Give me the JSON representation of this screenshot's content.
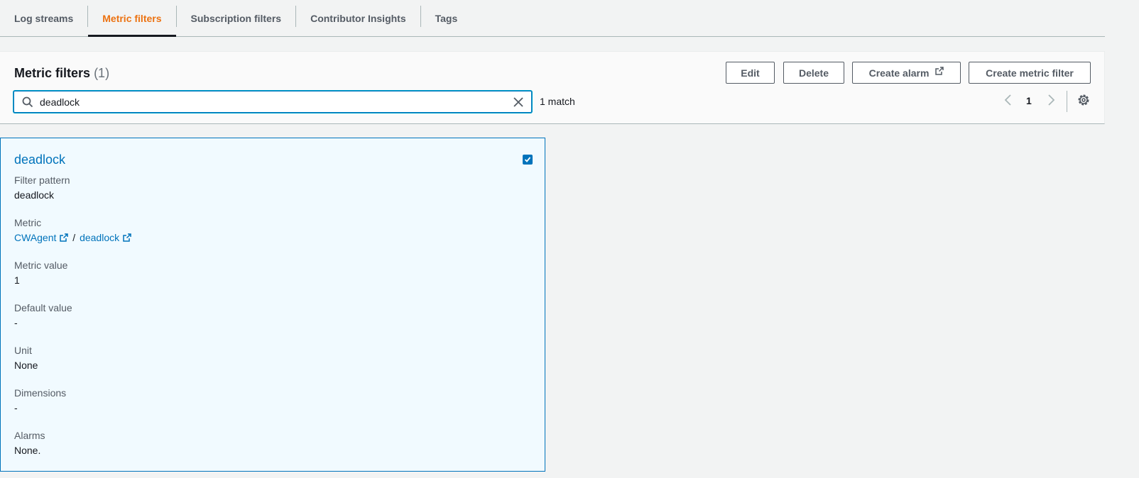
{
  "tabs": [
    {
      "label": "Log streams",
      "active": false
    },
    {
      "label": "Metric filters",
      "active": true
    },
    {
      "label": "Subscription filters",
      "active": false
    },
    {
      "label": "Contributor Insights",
      "active": false
    },
    {
      "label": "Tags",
      "active": false
    }
  ],
  "panel": {
    "title": "Metric filters",
    "count": "(1)",
    "buttons": {
      "edit": "Edit",
      "delete": "Delete",
      "create_alarm": "Create alarm",
      "create_metric_filter": "Create metric filter"
    },
    "search": {
      "value": "deadlock",
      "placeholder": ""
    },
    "match_text": "1 match",
    "page": "1"
  },
  "card": {
    "title": "deadlock",
    "checked": true,
    "filter_pattern": {
      "label": "Filter pattern",
      "value": "deadlock"
    },
    "metric": {
      "label": "Metric",
      "namespace": "CWAgent",
      "separator": "/",
      "name": "deadlock"
    },
    "metric_value": {
      "label": "Metric value",
      "value": "1"
    },
    "default_value": {
      "label": "Default value",
      "value": "-"
    },
    "unit": {
      "label": "Unit",
      "value": "None"
    },
    "dimensions": {
      "label": "Dimensions",
      "value": "-"
    },
    "alarms": {
      "label": "Alarms",
      "value": "None."
    }
  },
  "colors": {
    "accent_orange": "#ec7211",
    "link_blue": "#0073bb",
    "card_bg": "#f1faff",
    "page_bg": "#f2f3f3"
  }
}
